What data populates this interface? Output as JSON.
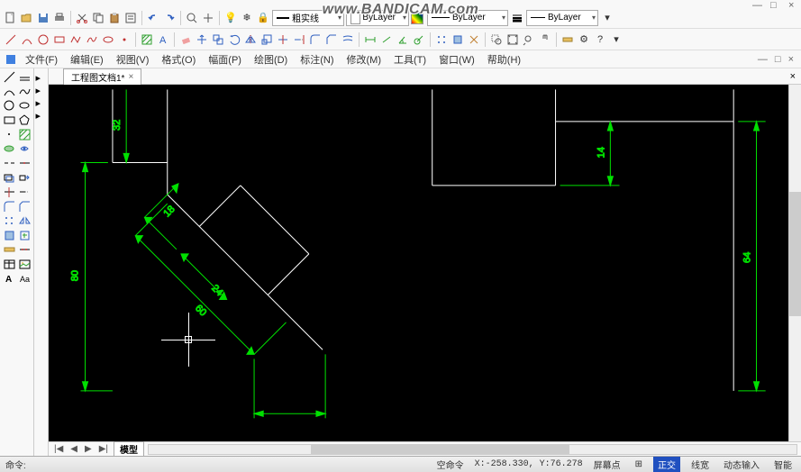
{
  "watermark": "www.BANDICAM.com",
  "titlebar": {
    "min": "—",
    "max": "□",
    "close": "×"
  },
  "toolbar_top": {
    "linetype_label": "粗实线",
    "color_label": "ByLayer",
    "ltype2_label": "ByLayer",
    "lweight_label": "ByLayer"
  },
  "menubar": {
    "file": "文件(F)",
    "edit": "编辑(E)",
    "view": "视图(V)",
    "format": "格式(O)",
    "canvas": "幅面(P)",
    "draw": "绘图(D)",
    "dimension": "标注(N)",
    "modify": "修改(M)",
    "tools": "工具(T)",
    "window": "窗口(W)",
    "help": "帮助(H)"
  },
  "tabs": {
    "doc1": "工程图文档1*",
    "close": "×"
  },
  "dimensions": {
    "d80": "80",
    "d32": "32",
    "d18": "18",
    "d24": "24",
    "d60": "60",
    "d14": "14",
    "d64": "64"
  },
  "bottom_tabs": {
    "first": "|◀",
    "prev": "◀",
    "next": "▶",
    "last": "▶|",
    "model": "模型"
  },
  "statusbar": {
    "cmd_prompt": "命令:",
    "empty_cmd": "空命令",
    "coords": "X:-258.330, Y:76.278",
    "screen": "屏幕点",
    "lw": "线宽",
    "dyn": "动态输入",
    "ortho": "正交",
    "smart": "智能"
  }
}
